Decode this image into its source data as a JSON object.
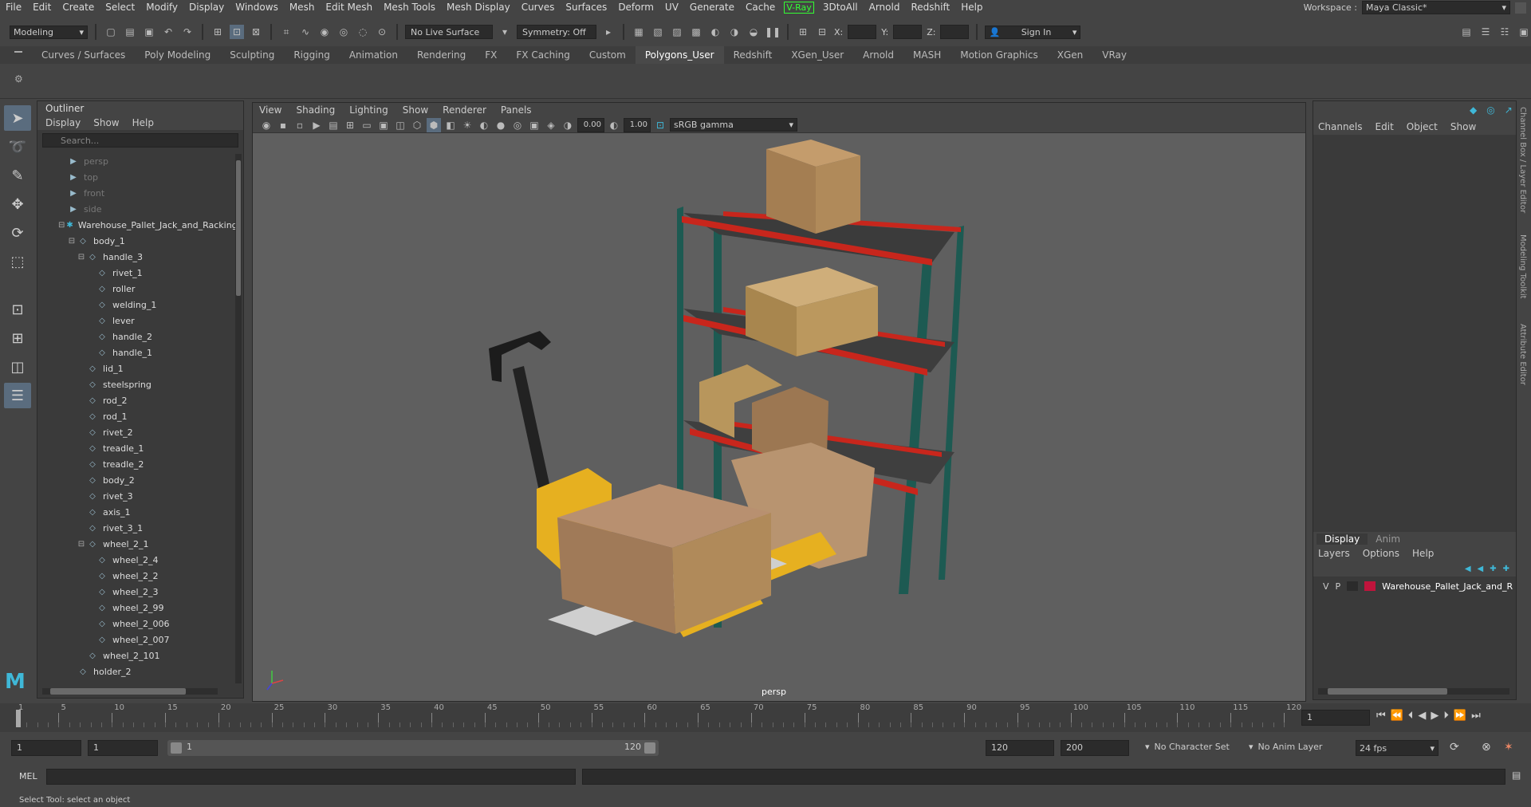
{
  "menubar": {
    "items": [
      "File",
      "Edit",
      "Create",
      "Select",
      "Modify",
      "Display",
      "Windows",
      "Mesh",
      "Edit Mesh",
      "Mesh Tools",
      "Mesh Display",
      "Curves",
      "Surfaces",
      "Deform",
      "UV",
      "Generate",
      "Cache"
    ],
    "vray": "V-Ray",
    "items2": [
      "3DtoAll",
      "Arnold",
      "Redshift",
      "Help"
    ],
    "workspace_label": "Workspace :",
    "workspace_value": "Maya Classic*"
  },
  "statusline": {
    "mode": "Modeling",
    "live_surface": "No Live Surface",
    "symmetry": "Symmetry: Off",
    "x_label": "X:",
    "y_label": "Y:",
    "z_label": "Z:",
    "signin": "Sign In"
  },
  "shelf": {
    "tabs": [
      "Curves / Surfaces",
      "Poly Modeling",
      "Sculpting",
      "Rigging",
      "Animation",
      "Rendering",
      "FX",
      "FX Caching",
      "Custom",
      "Polygons_User",
      "Redshift",
      "XGen_User",
      "Arnold",
      "MASH",
      "Motion Graphics",
      "XGen",
      "VRay"
    ],
    "active": "Polygons_User"
  },
  "outliner": {
    "title": "Outliner",
    "menu": [
      "Display",
      "Show",
      "Help"
    ],
    "search_placeholder": "Search...",
    "rows": [
      {
        "label": "persp",
        "indent": 0,
        "dim": true,
        "icon": "camera"
      },
      {
        "label": "top",
        "indent": 0,
        "dim": true,
        "icon": "camera"
      },
      {
        "label": "front",
        "indent": 0,
        "dim": true,
        "icon": "camera"
      },
      {
        "label": "side",
        "indent": 0,
        "dim": true,
        "icon": "camera"
      },
      {
        "label": "Warehouse_Pallet_Jack_and_Racking",
        "indent": 0,
        "dim": false,
        "icon": "group",
        "exp": "−"
      },
      {
        "label": "body_1",
        "indent": 1,
        "dim": false,
        "icon": "mesh",
        "exp": "−"
      },
      {
        "label": "handle_3",
        "indent": 2,
        "dim": false,
        "icon": "mesh",
        "exp": "−"
      },
      {
        "label": "rivet_1",
        "indent": 3,
        "dim": false,
        "icon": "mesh"
      },
      {
        "label": "roller",
        "indent": 3,
        "dim": false,
        "icon": "mesh"
      },
      {
        "label": "welding_1",
        "indent": 3,
        "dim": false,
        "icon": "mesh"
      },
      {
        "label": "lever",
        "indent": 3,
        "dim": false,
        "icon": "mesh"
      },
      {
        "label": "handle_2",
        "indent": 3,
        "dim": false,
        "icon": "mesh"
      },
      {
        "label": "handle_1",
        "indent": 3,
        "dim": false,
        "icon": "mesh"
      },
      {
        "label": "lid_1",
        "indent": 2,
        "dim": false,
        "icon": "mesh"
      },
      {
        "label": "steelspring",
        "indent": 2,
        "dim": false,
        "icon": "mesh"
      },
      {
        "label": "rod_2",
        "indent": 2,
        "dim": false,
        "icon": "mesh"
      },
      {
        "label": "rod_1",
        "indent": 2,
        "dim": false,
        "icon": "mesh"
      },
      {
        "label": "rivet_2",
        "indent": 2,
        "dim": false,
        "icon": "mesh"
      },
      {
        "label": "treadle_1",
        "indent": 2,
        "dim": false,
        "icon": "mesh"
      },
      {
        "label": "treadle_2",
        "indent": 2,
        "dim": false,
        "icon": "mesh"
      },
      {
        "label": "body_2",
        "indent": 2,
        "dim": false,
        "icon": "mesh"
      },
      {
        "label": "rivet_3",
        "indent": 2,
        "dim": false,
        "icon": "mesh"
      },
      {
        "label": "axis_1",
        "indent": 2,
        "dim": false,
        "icon": "mesh"
      },
      {
        "label": "rivet_3_1",
        "indent": 2,
        "dim": false,
        "icon": "mesh"
      },
      {
        "label": "wheel_2_1",
        "indent": 2,
        "dim": false,
        "icon": "mesh",
        "exp": "−"
      },
      {
        "label": "wheel_2_4",
        "indent": 3,
        "dim": false,
        "icon": "mesh"
      },
      {
        "label": "wheel_2_2",
        "indent": 3,
        "dim": false,
        "icon": "mesh"
      },
      {
        "label": "wheel_2_3",
        "indent": 3,
        "dim": false,
        "icon": "mesh"
      },
      {
        "label": "wheel_2_99",
        "indent": 3,
        "dim": false,
        "icon": "mesh"
      },
      {
        "label": "wheel_2_006",
        "indent": 3,
        "dim": false,
        "icon": "mesh"
      },
      {
        "label": "wheel_2_007",
        "indent": 3,
        "dim": false,
        "icon": "mesh"
      },
      {
        "label": "wheel_2_101",
        "indent": 2,
        "dim": false,
        "icon": "mesh"
      },
      {
        "label": "holder_2",
        "indent": 1,
        "dim": false,
        "icon": "mesh"
      }
    ]
  },
  "viewport": {
    "menu": [
      "View",
      "Shading",
      "Lighting",
      "Show",
      "Renderer",
      "Panels"
    ],
    "exposure": "0.00",
    "gamma": "1.00",
    "colorspace": "sRGB gamma",
    "camera_label": "persp"
  },
  "channelbox": {
    "menu": [
      "Channels",
      "Edit",
      "Object",
      "Show"
    ],
    "layer_tabs": [
      "Display",
      "Anim"
    ],
    "layer_menu": [
      "Layers",
      "Options",
      "Help"
    ],
    "layer": {
      "v": "V",
      "p": "P",
      "name": "Warehouse_Pallet_Jack_and_R",
      "color": "#c0143c"
    }
  },
  "sidetabs": [
    "Channel Box / Layer Editor",
    "Modeling Toolkit",
    "Attribute Editor"
  ],
  "timeslider": {
    "ticks": [
      "1",
      "5",
      "10",
      "15",
      "20",
      "25",
      "30",
      "35",
      "40",
      "45",
      "50",
      "55",
      "60",
      "65",
      "70",
      "75",
      "80",
      "85",
      "90",
      "95",
      "100",
      "105",
      "110",
      "115",
      "120"
    ],
    "current_frame": "1"
  },
  "range": {
    "start": "1",
    "playback_start": "1",
    "slider_start": "1",
    "slider_end": "120",
    "end": "120",
    "max": "200",
    "character_set": "No Character Set",
    "anim_layer": "No Anim Layer",
    "fps": "24 fps"
  },
  "cmd": {
    "label": "MEL"
  },
  "help": "Select Tool: select an object",
  "colors": {
    "rack_upright": "#1d5a52",
    "rack_beam": "#c8261c",
    "box": "#b08a5a",
    "jack": "#e6b020"
  }
}
